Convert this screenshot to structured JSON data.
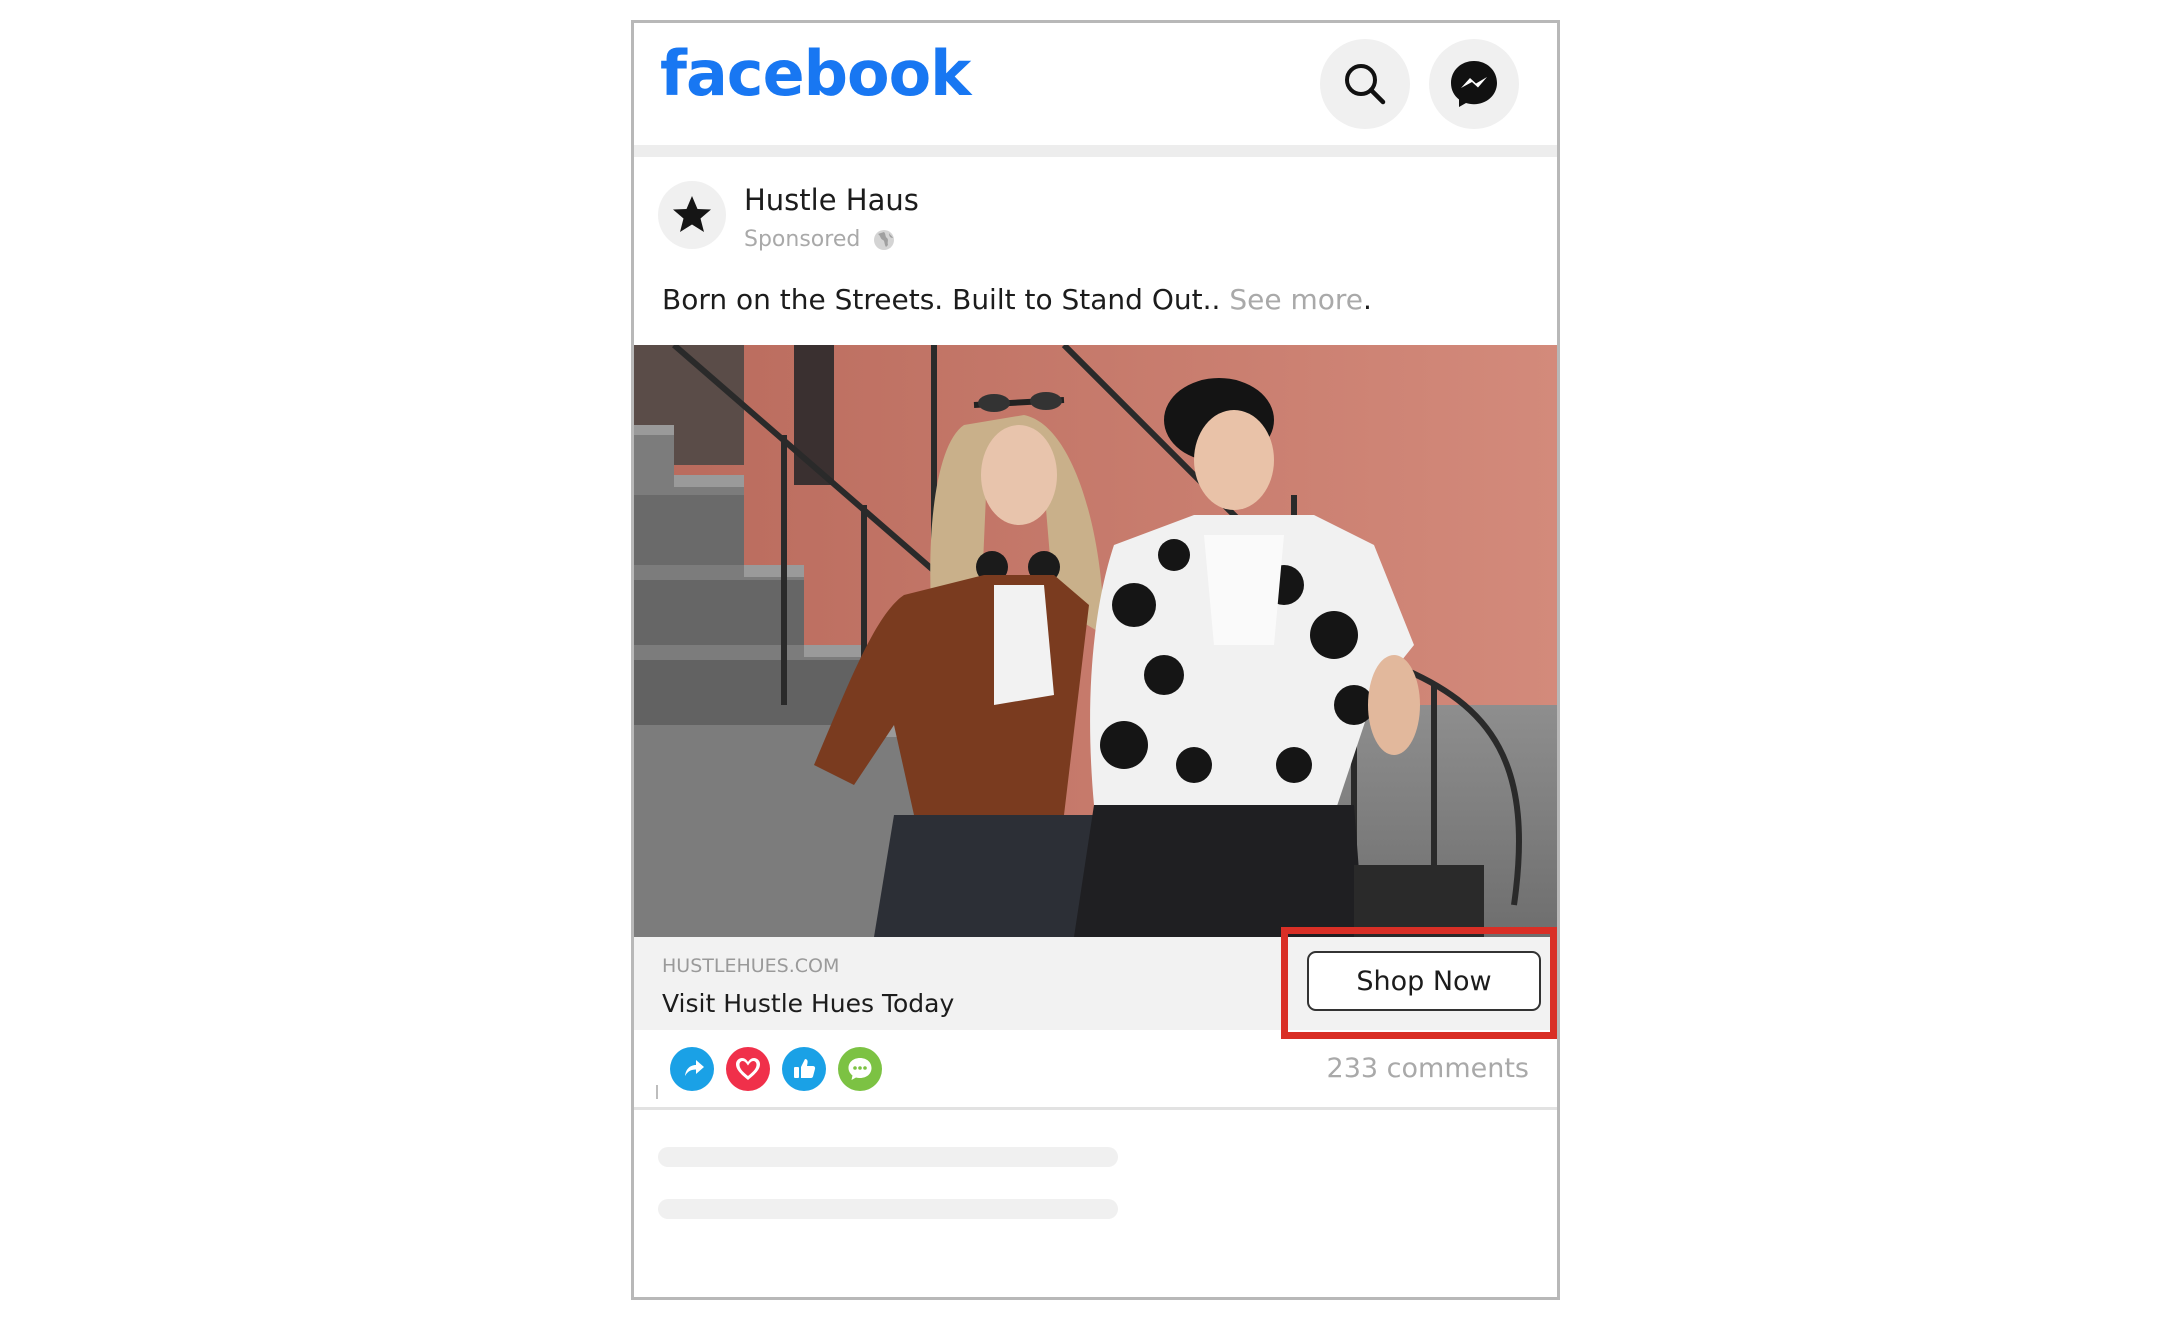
{
  "header": {
    "logo_text": "facebook",
    "search_icon": "search-icon",
    "messenger_icon": "messenger-icon",
    "accent_color": "#1877f2"
  },
  "post": {
    "page_name": "Hustle Haus",
    "sponsored_label": "Sponsored",
    "avatar_icon": "star-icon",
    "privacy_icon": "globe-icon",
    "caption": "Born on the Streets. Built to Stand Out.. ",
    "see_more": "See more",
    "caption_end": ".",
    "photo_icon": "street-fashion-photo"
  },
  "link": {
    "domain": "HUSTLEHUES.COM",
    "title": "Visit Hustle Hues Today",
    "cta_label": "Shop Now",
    "highlight_color": "#d92f26"
  },
  "engagement": {
    "reaction_icons": [
      "share-icon",
      "love-icon",
      "like-icon",
      "comment-icon"
    ],
    "comments_label": "233 comments"
  }
}
